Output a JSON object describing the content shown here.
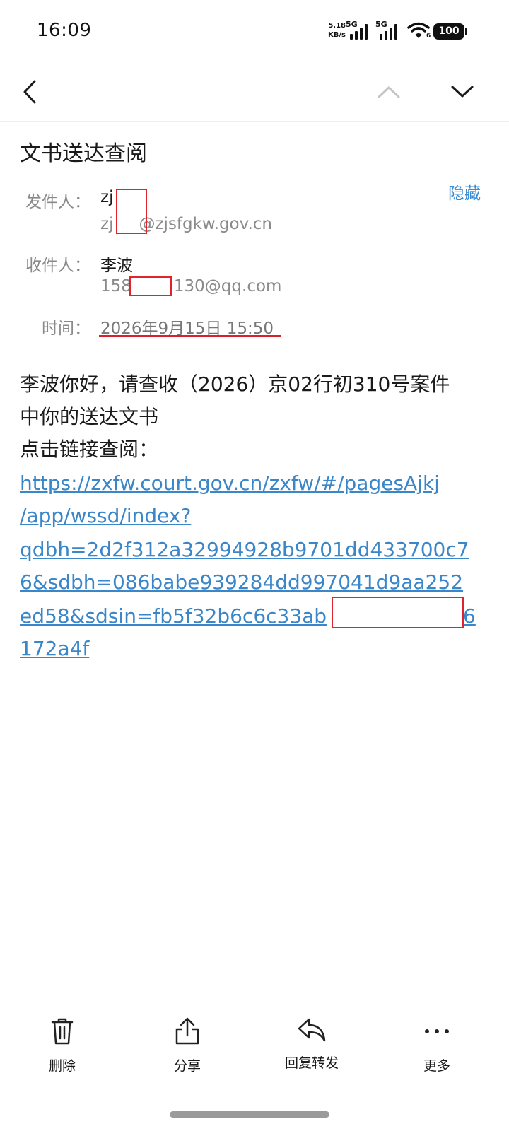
{
  "status_bar": {
    "time": "16:09",
    "net_speed": "5.18",
    "net_unit": "KB/s",
    "sim1": "5G",
    "sim2": "5G",
    "wifi_badge": "6",
    "battery": "100"
  },
  "nav": {
    "back_icon": "chevron-left-icon",
    "prev_icon": "chevron-up-icon",
    "next_icon": "chevron-down-icon"
  },
  "email": {
    "subject": "文书送达查阅",
    "hide_label": "隐藏",
    "sender_label": "发件人：",
    "sender_name": "zj",
    "sender_email_prefix": "zj",
    "sender_email_suffix": "@zjsfgkw.gov.cn",
    "recipient_label": "收件人：",
    "recipient_name": "李波",
    "recipient_email_prefix": "158",
    "recipient_email_suffix": "130@qq.com",
    "time_label": "时间：",
    "time_value": "2026年9月15日 15:50"
  },
  "body": {
    "line1": "李波你好，请查收（2026）京02行初310号案件",
    "line2": "中你的送达文书",
    "line3": "点击链接查阅：",
    "link_lines": [
      "https://zxfw.court.gov.cn/zxfw/#/pagesAjkj",
      "/app/wssd/index?",
      "qdbh=2d2f312a32994928b9701dd433700c7",
      "6&sdbh=086babe939284dd997041d9aa252",
      "ed58&sdsin=fb5f32b6c6c33ab",
      "172a4f"
    ],
    "link_line5_tail": "6"
  },
  "toolbar": {
    "delete": "删除",
    "share": "分享",
    "reply_forward": "回复转发",
    "more": "更多"
  },
  "colors": {
    "accent": "#3a86c8",
    "redaction": "#e0242d"
  }
}
